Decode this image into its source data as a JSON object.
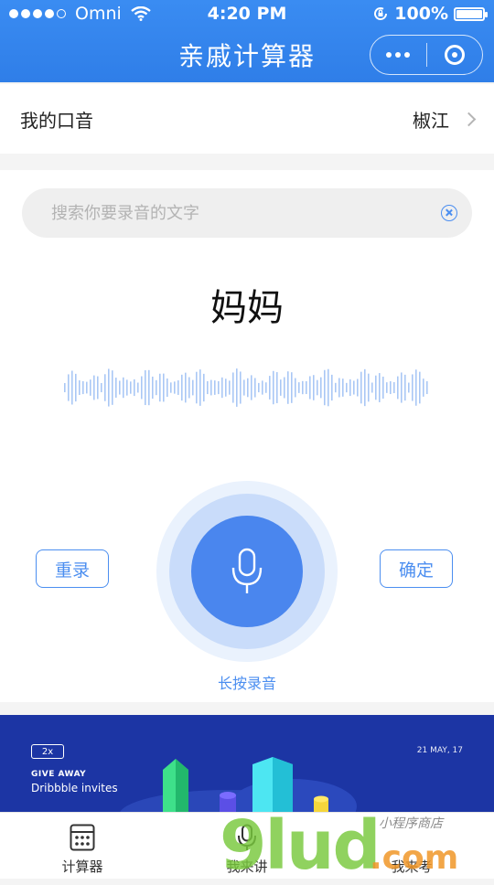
{
  "status_bar": {
    "carrier": "Omni",
    "time": "4:20 PM",
    "battery": "100%",
    "battery_level": 1.0
  },
  "header": {
    "title": "亲戚计算器"
  },
  "accent": {
    "label": "我的口音",
    "value": "椒江"
  },
  "search": {
    "placeholder": "搜索你要录音的文字",
    "value": ""
  },
  "recording": {
    "word": "妈妈",
    "re_record_label": "重录",
    "confirm_label": "确定",
    "hold_hint": "长按录音"
  },
  "banner": {
    "badge": "2x",
    "line1": "GIVE AWAY",
    "line2": "Dribbble invites",
    "date": "21 MAY, 17"
  },
  "tabs": [
    {
      "label": "计算器",
      "icon": "calculator-icon",
      "active": true
    },
    {
      "label": "我来讲",
      "icon": "microphone-icon",
      "active": false
    },
    {
      "label": "我来考",
      "icon": "",
      "active": false
    }
  ],
  "watermark": {
    "brand": "9lud",
    "tld": ".com",
    "subtitle": "小程序商店"
  },
  "colors": {
    "primary": "#3a8cf2",
    "accent_blue": "#4b8ef0",
    "banner_bg": "#1c35a4"
  }
}
